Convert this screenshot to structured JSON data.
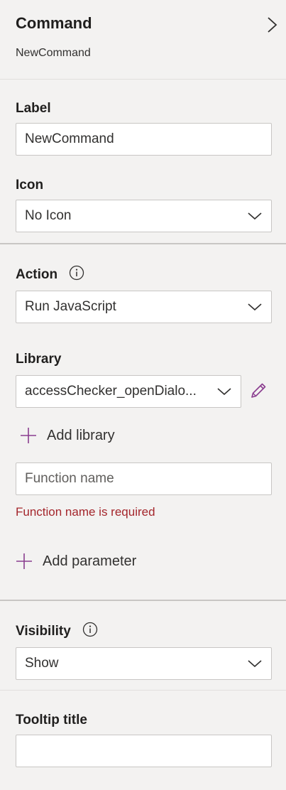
{
  "header": {
    "title": "Command",
    "subtitle": "NewCommand"
  },
  "label_section": {
    "label": "Label",
    "value": "NewCommand"
  },
  "icon_section": {
    "label": "Icon",
    "selected": "No Icon"
  },
  "action_section": {
    "label": "Action",
    "selected": "Run JavaScript"
  },
  "library_section": {
    "label": "Library",
    "selected": "accessChecker_openDialo...",
    "add_library_label": "Add library",
    "function_placeholder": "Function name",
    "function_value": "",
    "error": "Function name is required",
    "add_parameter_label": "Add parameter"
  },
  "visibility_section": {
    "label": "Visibility",
    "selected": "Show"
  },
  "tooltip_section": {
    "label": "Tooltip title",
    "value": ""
  },
  "colors": {
    "accent": "#8a3d8f",
    "error": "#a4262c",
    "background": "#f3f2f1"
  }
}
